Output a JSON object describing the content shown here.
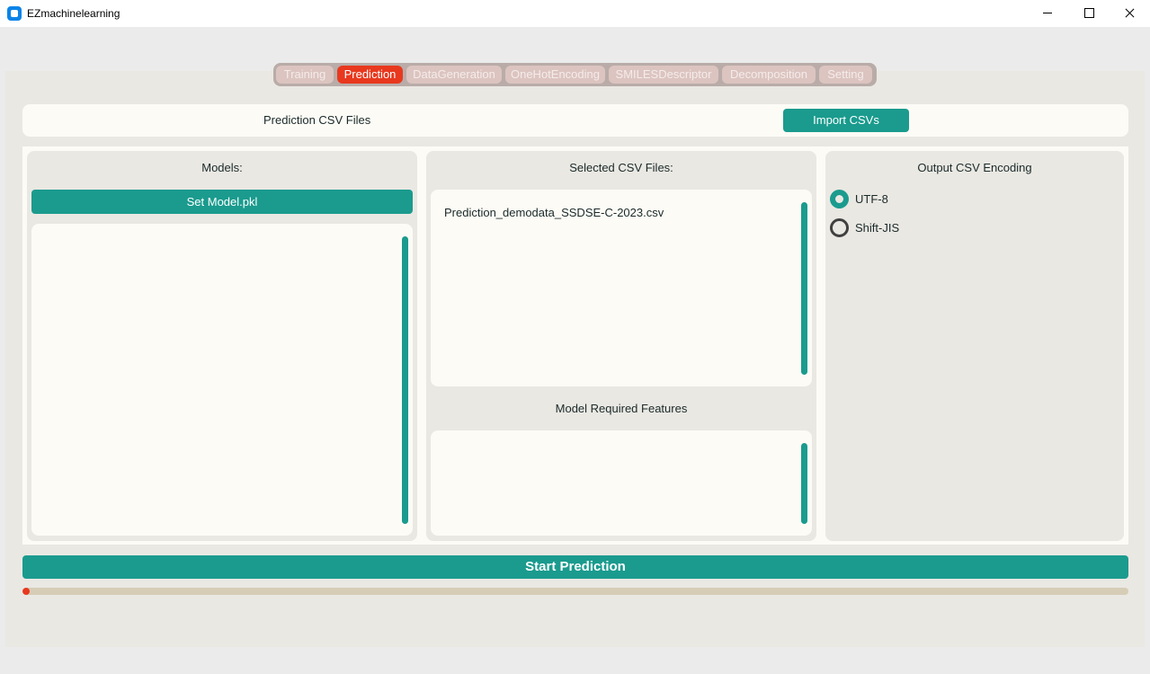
{
  "window": {
    "title": "EZmachinelearning"
  },
  "tabs": [
    {
      "label": "Training",
      "active": false
    },
    {
      "label": "Prediction",
      "active": true
    },
    {
      "label": "DataGeneration",
      "active": false
    },
    {
      "label": "OneHotEncoding",
      "active": false
    },
    {
      "label": "SMILESDescriptor",
      "active": false
    },
    {
      "label": "Decomposition",
      "active": false
    },
    {
      "label": "Setting",
      "active": false
    }
  ],
  "header": {
    "label": "Prediction CSV Files",
    "import_button": "Import CSVs"
  },
  "models": {
    "title": "Models:",
    "set_button": "Set Model.pkl",
    "items": []
  },
  "csv": {
    "title": "Selected CSV Files:",
    "files": [
      "Prediction_demodata_SSDSE-C-2023.csv"
    ]
  },
  "features": {
    "title": "Model Required Features",
    "items": []
  },
  "encoding": {
    "title": "Output CSV Encoding",
    "options": [
      {
        "label": "UTF-8",
        "selected": true
      },
      {
        "label": "Shift-JIS",
        "selected": false
      }
    ]
  },
  "start_button": "Start Prediction",
  "progress": 0.003,
  "colors": {
    "accent": "#1a9b8e",
    "active_tab": "#e8381e",
    "inactive_tab": "#dcc4c0",
    "progress_track": "#d6cdb6"
  }
}
